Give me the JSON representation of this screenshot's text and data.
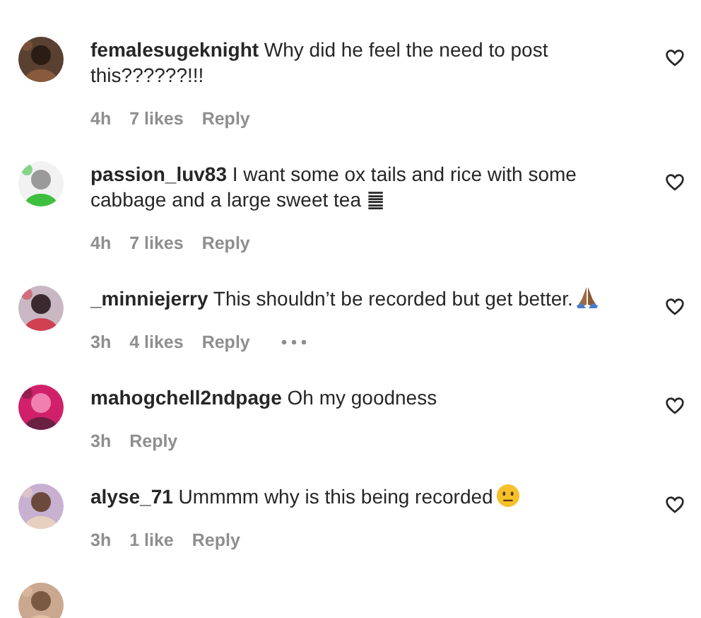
{
  "comments": [
    {
      "username": "femalesugeknight",
      "text": "Why did he feel the need to post this??????!!!",
      "time": "4h",
      "likes": "7 likes",
      "reply": "Reply",
      "liked": false
    },
    {
      "username": "passion_luv83",
      "text": "I want some ox tails and rice with some cabbage and a large sweet tea ䷀",
      "time": "4h",
      "likes": "7 likes",
      "reply": "Reply",
      "liked": false
    },
    {
      "username": "_minniejerry",
      "text": "This shouldn’t be recorded but get better.",
      "emoji": {
        "kind": "pray"
      },
      "time": "3h",
      "likes": "4 likes",
      "reply": "Reply",
      "more": true,
      "liked": false
    },
    {
      "username": "mahogchell2ndpage",
      "text": "Oh my goodness",
      "time": "3h",
      "reply": "Reply",
      "liked": false
    },
    {
      "username": "alyse_71",
      "text": "Ummmm why is this being recorded",
      "emoji": {
        "kind": "neutral-face"
      },
      "time": "3h",
      "likes": "1 like",
      "reply": "Reply",
      "liked": false
    }
  ]
}
